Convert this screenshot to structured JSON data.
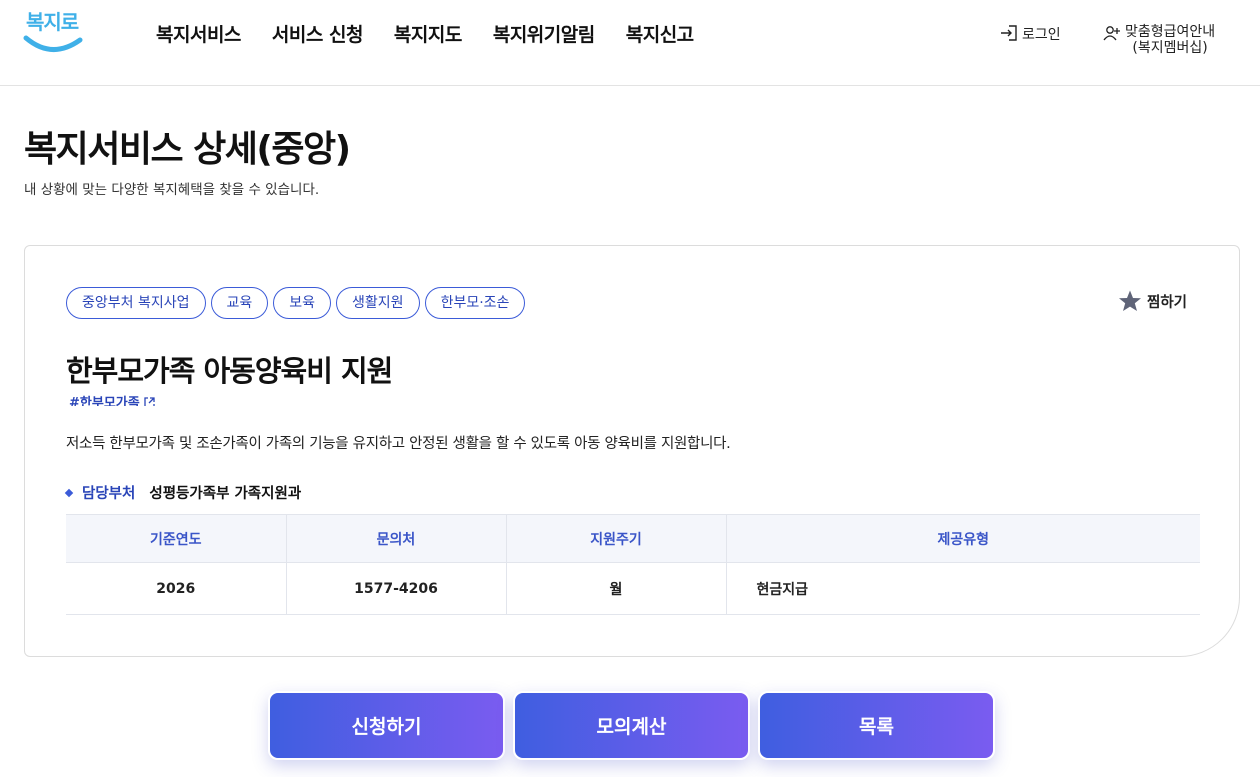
{
  "header": {
    "logo_text": "복지로",
    "nav": [
      "복지서비스",
      "서비스 신청",
      "복지지도",
      "복지위기알림",
      "복지신고"
    ],
    "login_label": "로그인",
    "member_label_line1": "맞춤형급여안내",
    "member_label_line2": "(복지멤버십)"
  },
  "page": {
    "title": "복지서비스 상세(중앙)",
    "subtitle": "내 상황에 맞는 다양한 복지혜택을 찾을 수 있습니다."
  },
  "service": {
    "tags": [
      "중앙부처 복지사업",
      "교육",
      "보육",
      "생활지원",
      "한부모·조손"
    ],
    "favorite_label": "찜하기",
    "title": "한부모가족 아동양육비 지원",
    "hashtag": "#한부모가족",
    "description": "저소득 한부모가족 및 조손가족이 가족의 기능을 유지하고 안정된 생활을 할 수 있도록 아동 양육비를 지원합니다.",
    "dept_label": "담당부처",
    "dept_value": "성평등가족부 가족지원과",
    "table": {
      "headers": [
        "기준연도",
        "문의처",
        "지원주기",
        "제공유형"
      ],
      "row": [
        "2026",
        "1577-4206",
        "월",
        "현금지급"
      ]
    }
  },
  "buttons": {
    "apply": "신청하기",
    "simulate": "모의계산",
    "list": "목록"
  },
  "colors": {
    "accent": "#3b5bd8",
    "button_gradient_start": "#3f5ee0",
    "button_gradient_end": "#7a5cf0",
    "logo": "#3fb0e8"
  }
}
